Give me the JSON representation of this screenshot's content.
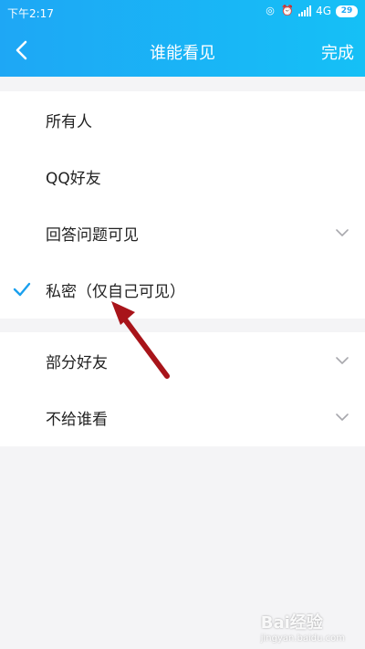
{
  "status": {
    "time": "下午2:17",
    "network": "4G",
    "battery": "29"
  },
  "nav": {
    "title": "谁能看见",
    "done": "完成"
  },
  "options_group1": [
    {
      "label": "所有人",
      "checked": false,
      "expandable": false
    },
    {
      "label": "QQ好友",
      "checked": false,
      "expandable": false
    },
    {
      "label": "回答问题可见",
      "checked": false,
      "expandable": true
    },
    {
      "label": "私密（仅自己可见）",
      "checked": true,
      "expandable": false
    }
  ],
  "options_group2": [
    {
      "label": "部分好友",
      "expandable": true
    },
    {
      "label": "不给谁看",
      "expandable": true
    }
  ],
  "colors": {
    "accent": "#1ea7f5",
    "check": "#1aa0ee",
    "annotation_arrow": "#a8141a"
  },
  "watermark": {
    "brand": "Bai经验",
    "url": "jingyan.baidu.com"
  }
}
